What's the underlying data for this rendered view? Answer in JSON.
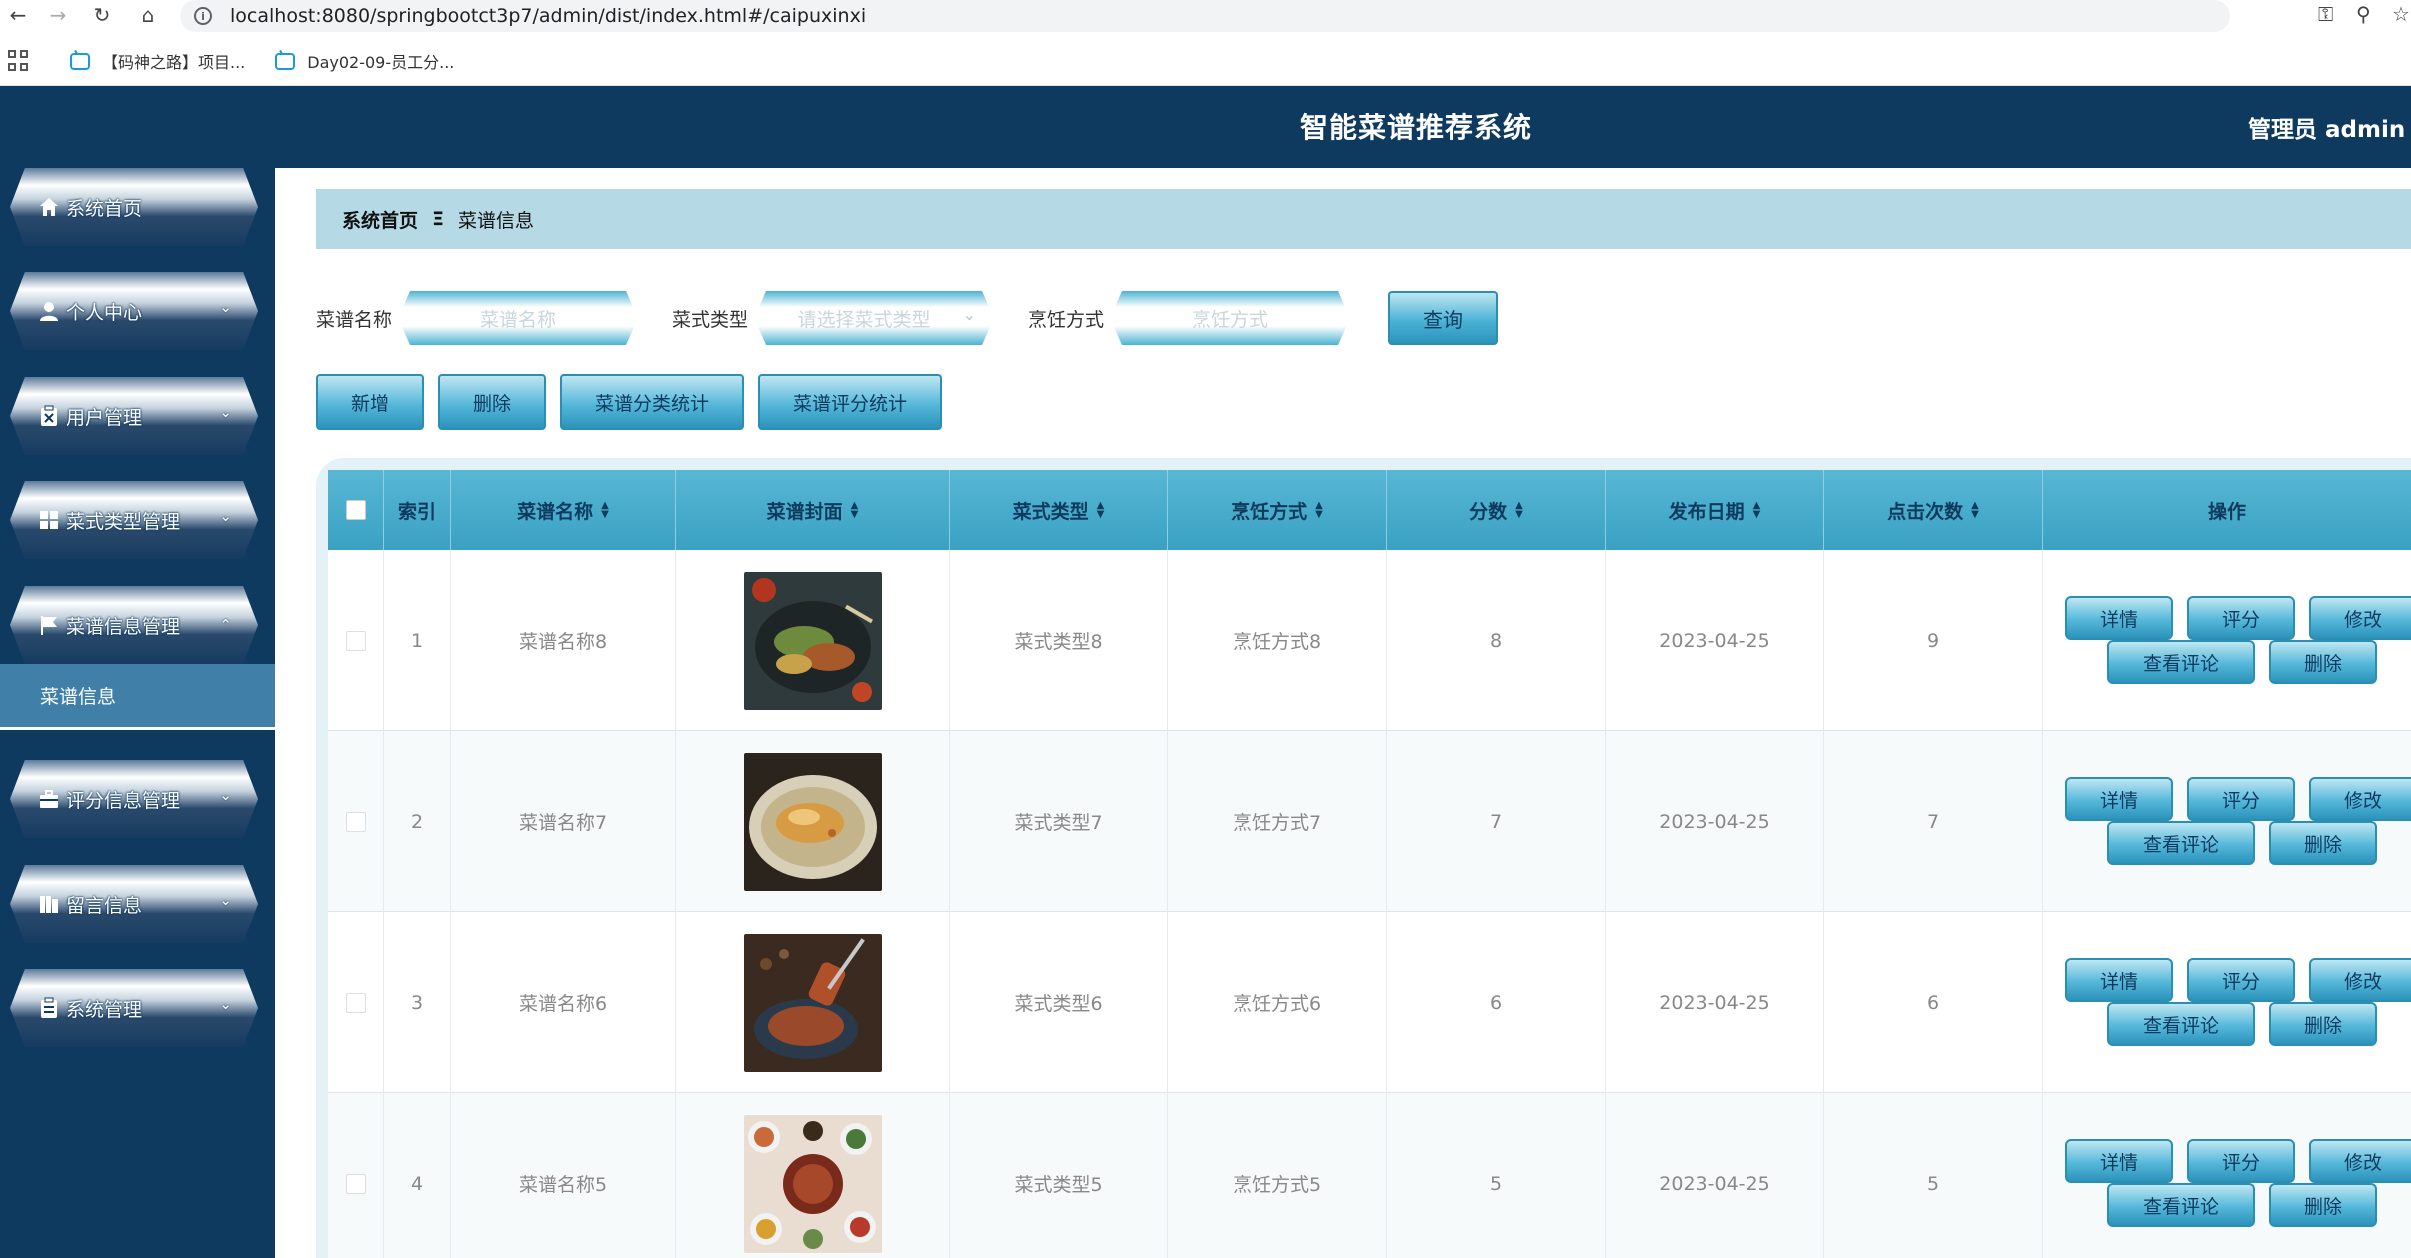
{
  "browser": {
    "url": "localhost:8080/springbootct3p7/admin/dist/index.html#/caipuxinxi",
    "bookmarks": [
      {
        "label": "【码神之路】项目..."
      },
      {
        "label": "Day02-09-员工分..."
      }
    ]
  },
  "header": {
    "title": "智能菜谱推荐系统",
    "user": "管理员 admin  退"
  },
  "sidebar": {
    "items": [
      {
        "label": "系统首页",
        "icon": "home-icon",
        "has_arrow": false
      },
      {
        "label": "个人中心",
        "icon": "user-icon",
        "has_arrow": true
      },
      {
        "label": "用户管理",
        "icon": "clipboard-x-icon",
        "has_arrow": true
      },
      {
        "label": "菜式类型管理",
        "icon": "grid-icon",
        "has_arrow": true
      },
      {
        "label": "菜谱信息管理",
        "icon": "flag-icon",
        "has_arrow": true,
        "expanded": true
      },
      {
        "label": "评分信息管理",
        "icon": "briefcase-icon",
        "has_arrow": true
      },
      {
        "label": "留言信息",
        "icon": "book-icon",
        "has_arrow": true
      },
      {
        "label": "系统管理",
        "icon": "clipboard-icon",
        "has_arrow": true
      }
    ],
    "active_submenu": "菜谱信息"
  },
  "breadcrumb": {
    "home": "系统首页",
    "separator": "Ξ",
    "current": "菜谱信息"
  },
  "search": {
    "name_label": "菜谱名称",
    "name_placeholder": "菜谱名称",
    "type_label": "菜式类型",
    "type_placeholder": "请选择菜式类型",
    "method_label": "烹饪方式",
    "method_placeholder": "烹饪方式",
    "query_label": "查询"
  },
  "actions": {
    "add": "新增",
    "delete": "删除",
    "category_stats": "菜谱分类统计",
    "score_stats": "菜谱评分统计"
  },
  "table": {
    "columns": {
      "index": "索引",
      "name": "菜谱名称",
      "cover": "菜谱封面",
      "type": "菜式类型",
      "method": "烹饪方式",
      "score": "分数",
      "date": "发布日期",
      "clicks": "点击次数",
      "ops": "操作"
    },
    "row_buttons": {
      "detail": "详情",
      "rate": "评分",
      "edit": "修改",
      "comments": "查看评论",
      "delete": "删除"
    },
    "rows": [
      {
        "index": "1",
        "name": "菜谱名称8",
        "type": "菜式类型8",
        "method": "烹饪方式8",
        "score": "8",
        "date": "2023-04-25",
        "clicks": "9",
        "cover": "grilled-vegetables-image"
      },
      {
        "index": "2",
        "name": "菜谱名称7",
        "type": "菜式类型7",
        "method": "烹饪方式7",
        "score": "7",
        "date": "2023-04-25",
        "clicks": "7",
        "cover": "fried-fish-image"
      },
      {
        "index": "3",
        "name": "菜谱名称6",
        "type": "菜式类型6",
        "method": "烹饪方式6",
        "score": "6",
        "date": "2023-04-25",
        "clicks": "6",
        "cover": "skewer-dish-image"
      },
      {
        "index": "4",
        "name": "菜谱名称5",
        "type": "菜式类型5",
        "method": "烹饪方式5",
        "score": "5",
        "date": "2023-04-25",
        "clicks": "5",
        "cover": "table-spread-image"
      }
    ]
  }
}
